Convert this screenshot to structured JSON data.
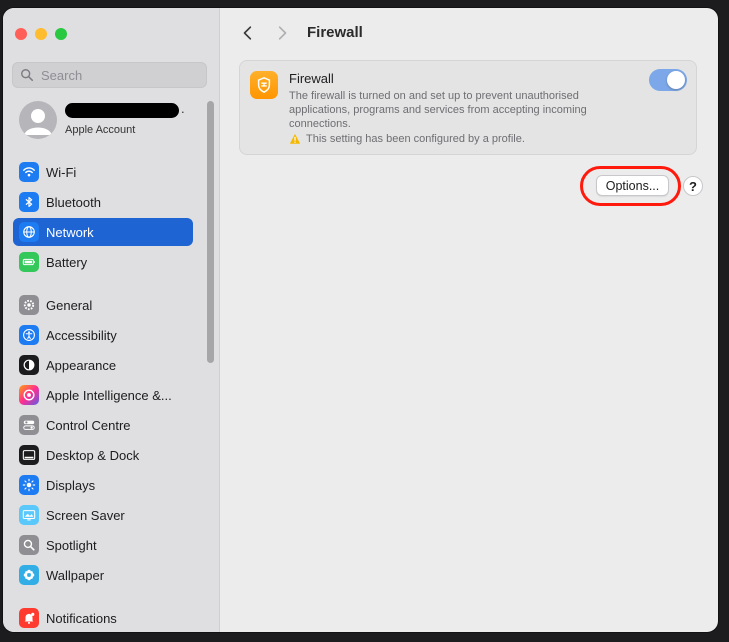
{
  "sidebar": {
    "search_placeholder": "Search",
    "account": {
      "label": "Apple Account",
      "trailing": "."
    },
    "items": [
      {
        "key": "wifi",
        "label": "Wi-Fi",
        "icon": "wifi-icon",
        "color": "#1e7cf2",
        "selected": false
      },
      {
        "key": "bluetooth",
        "label": "Bluetooth",
        "icon": "bluetooth-icon",
        "color": "#1e7cf2",
        "selected": false
      },
      {
        "key": "network",
        "label": "Network",
        "icon": "globe-icon",
        "color": "#1e7cf2",
        "selected": true
      },
      {
        "key": "battery",
        "label": "Battery",
        "icon": "battery-icon",
        "color": "#34c759",
        "selected": false
      },
      {
        "key": "general",
        "label": "General",
        "icon": "gear-icon",
        "color": "#8e8e93",
        "selected": false
      },
      {
        "key": "accessibility",
        "label": "Accessibility",
        "icon": "accessibility-icon",
        "color": "#1e7cf2",
        "selected": false
      },
      {
        "key": "appearance",
        "label": "Appearance",
        "icon": "appearance-icon",
        "color": "#1c1c1e",
        "selected": false
      },
      {
        "key": "apple-intelligence",
        "label": "Apple Intelligence &...",
        "icon": "apple-intelligence-icon",
        "color": "#ff6b9a",
        "selected": false
      },
      {
        "key": "control-centre",
        "label": "Control Centre",
        "icon": "control-centre-icon",
        "color": "#8e8e93",
        "selected": false
      },
      {
        "key": "desktop-dock",
        "label": "Desktop & Dock",
        "icon": "dock-icon",
        "color": "#1c1c1e",
        "selected": false
      },
      {
        "key": "displays",
        "label": "Displays",
        "icon": "displays-icon",
        "color": "#1e7cf2",
        "selected": false
      },
      {
        "key": "screen-saver",
        "label": "Screen Saver",
        "icon": "screen-saver-icon",
        "color": "#5ac8fa",
        "selected": false
      },
      {
        "key": "spotlight",
        "label": "Spotlight",
        "icon": "spotlight-icon",
        "color": "#8e8e93",
        "selected": false
      },
      {
        "key": "wallpaper",
        "label": "Wallpaper",
        "icon": "wallpaper-icon",
        "color": "#32ade6",
        "selected": false
      },
      {
        "key": "notifications",
        "label": "Notifications",
        "icon": "notifications-icon",
        "color": "#ff3b30",
        "selected": false
      }
    ]
  },
  "main": {
    "title": "Firewall",
    "card": {
      "title": "Firewall",
      "description": "The firewall is turned on and set up to prevent unauthorised applications, programs and services from accepting incoming connections.",
      "note": "This setting has been configured by a profile.",
      "enabled": true
    },
    "options_label": "Options...",
    "help_label": "?"
  },
  "colors": {
    "accent": "#1e64d3",
    "highlight_ring": "#ff1a0d",
    "firewall_icon": "#ff9500"
  }
}
